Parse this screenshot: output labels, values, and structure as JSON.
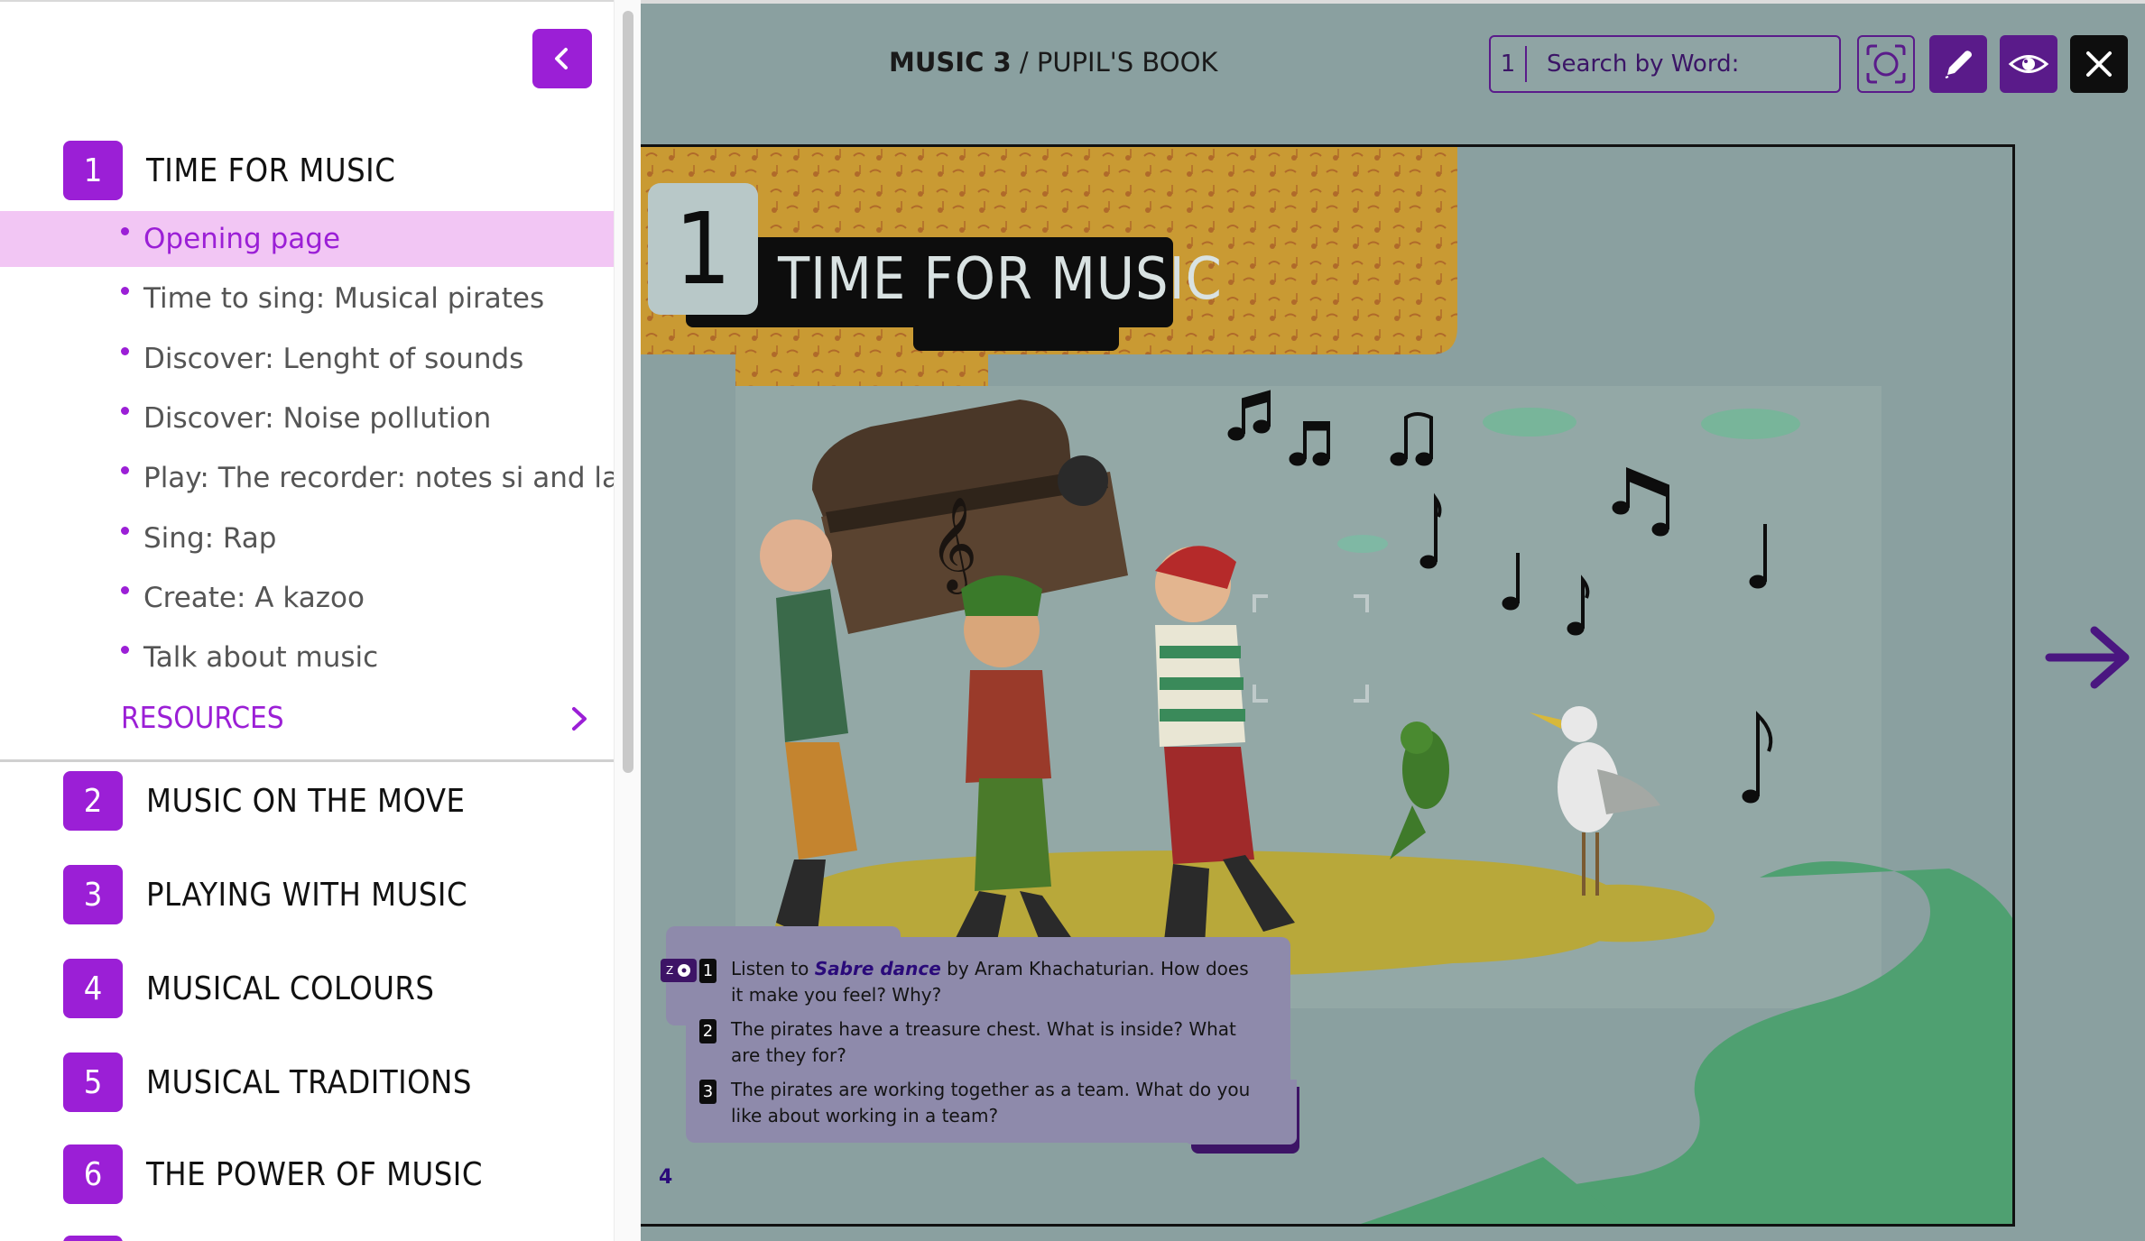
{
  "sidebar": {
    "units": [
      {
        "num": "1",
        "title": "TIME FOR MUSIC"
      },
      {
        "num": "2",
        "title": "MUSIC ON THE MOVE"
      },
      {
        "num": "3",
        "title": "PLAYING WITH MUSIC"
      },
      {
        "num": "4",
        "title": "MUSICAL COLOURS"
      },
      {
        "num": "5",
        "title": "MUSICAL TRADITIONS"
      },
      {
        "num": "6",
        "title": "THE POWER OF MUSIC"
      }
    ],
    "lessons": [
      "Opening page",
      "Time to sing: Musical pirates",
      "Discover: Lenght of sounds",
      "Discover: Noise pollution",
      "Play: The recorder: notes si and la",
      "Sing: Rap",
      "Create: A kazoo",
      "Talk about music"
    ],
    "active_lesson": "Opening page",
    "resources_label": "RESOURCES"
  },
  "viewer": {
    "title_bold": "MUSIC 3",
    "title_rest": " / PUPIL'S BOOK",
    "search": {
      "page": "1",
      "placeholder": "Search by Word:"
    },
    "icons": {
      "collapse": "chevron-left-icon",
      "snapshot": "screenshot-icon",
      "pen": "pencil-icon",
      "eye": "eye-icon",
      "close": "close-icon",
      "next": "arrow-right-icon",
      "resources": "chevron-right-icon"
    },
    "colors": {
      "accent": "#9b1fd6",
      "dark_purple": "#5a1b8a",
      "active_row": "#f2c6f4",
      "viewer_bg": "#8aa0a0"
    }
  },
  "page": {
    "unit_number": "1",
    "unit_title": "TIME FOR MUSIC",
    "audio_chip_label": "Z",
    "questions": [
      {
        "num": "1",
        "before": "Listen to ",
        "em": "Sabre dance",
        "after": " by Aram Khachaturian. How does it make you feel? Why?"
      },
      {
        "num": "2",
        "before": "The pirates have a treasure chest. What is inside? What are they for?",
        "em": "",
        "after": ""
      },
      {
        "num": "3",
        "before": "The pirates are working together as a team. What do you like about working in a team?",
        "em": "",
        "after": ""
      }
    ],
    "page_number": "4"
  }
}
